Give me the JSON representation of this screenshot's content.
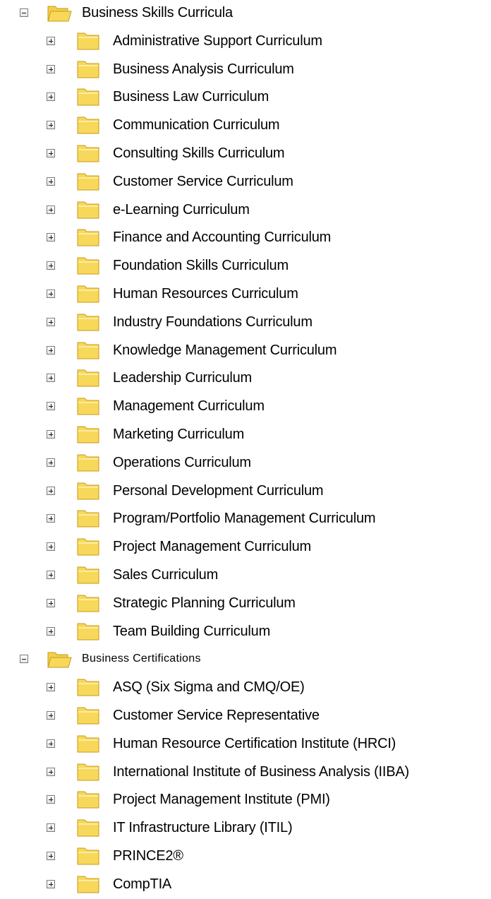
{
  "icons": {
    "toggle_expand": "plus-box-icon",
    "toggle_collapse": "minus-box-icon",
    "folder_closed": "folder-icon",
    "folder_open": "open-folder-icon"
  },
  "colors": {
    "folder_fill": "#f7d85a",
    "folder_edge": "#c99a1a",
    "toggle_border": "#7a7a7a"
  },
  "tree": {
    "business_skills": {
      "label": "Business Skills Curricula",
      "expanded": true,
      "children": [
        "Administrative Support Curriculum",
        "Business Analysis Curriculum",
        "Business Law Curriculum",
        "Communication Curriculum",
        "Consulting Skills Curriculum",
        "Customer Service Curriculum",
        "e-Learning Curriculum",
        "Finance and Accounting Curriculum",
        "Foundation Skills Curriculum",
        "Human Resources Curriculum",
        "Industry Foundations Curriculum",
        "Knowledge Management Curriculum",
        "Leadership Curriculum",
        "Management Curriculum",
        "Marketing Curriculum",
        "Operations Curriculum",
        "Personal Development Curriculum",
        "Program/Portfolio Management Curriculum",
        "Project Management Curriculum",
        "Sales Curriculum",
        "Strategic Planning Curriculum",
        "Team Building Curriculum"
      ]
    },
    "business_certifications": {
      "label": "Business Certifications",
      "expanded": true,
      "children": [
        "ASQ (Six Sigma and CMQ/OE)",
        "Customer Service Representative",
        "Human Resource Certification Institute (HRCI)",
        "International Institute of Business Analysis (IIBA)",
        "Project Management Institute (PMI)",
        "IT Infrastructure Library (ITIL)",
        "PRINCE2®",
        "CompTIA"
      ]
    }
  }
}
